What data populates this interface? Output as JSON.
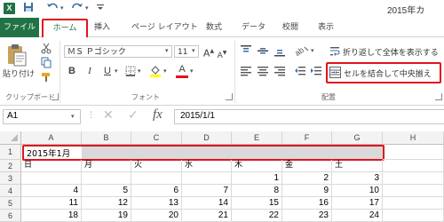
{
  "titlebar": {
    "app_logo": "X",
    "save_icon": "save-icon",
    "undo_icon": "undo-icon",
    "redo_icon": "redo-icon",
    "title": "2015年カ"
  },
  "ribbon_tabs": [
    "ファイル",
    "ホーム",
    "挿入",
    "ページ レイアウト",
    "数式",
    "データ",
    "校閲",
    "表示"
  ],
  "clipboard": {
    "paste_label": "貼り付け",
    "group_label": "クリップボード"
  },
  "font": {
    "font_name": "ＭＳ Ｐゴシック",
    "font_size": "11",
    "bold": "B",
    "italic": "I",
    "underline": "U",
    "group_label": "フォント",
    "font_color": "#e0141e"
  },
  "alignment": {
    "wrap_text_label": "折り返して全体を表示する",
    "merge_center_label": "セルを結合して中央揃え",
    "group_label": "配置"
  },
  "formula_bar": {
    "name_box": "A1",
    "cancel": "✕",
    "enter": "✓",
    "fx": "fx",
    "value": "2015/1/1"
  },
  "grid": {
    "columns": [
      "A",
      "B",
      "C",
      "D",
      "E",
      "F",
      "G",
      "H"
    ],
    "rows": [
      "1",
      "2",
      "3",
      "4",
      "5",
      "6"
    ],
    "a1_value": "2015年1月",
    "weekdays": [
      "日",
      "月",
      "火",
      "水",
      "木",
      "金",
      "土"
    ],
    "row3": [
      "",
      "",
      "",
      "",
      "1",
      "2",
      "3"
    ],
    "row4": [
      "4",
      "5",
      "6",
      "7",
      "8",
      "9",
      "10"
    ],
    "row5": [
      "11",
      "12",
      "13",
      "14",
      "15",
      "16",
      "17"
    ],
    "row6": [
      "18",
      "19",
      "20",
      "21",
      "22",
      "23",
      "24"
    ]
  },
  "colors": {
    "excel_green": "#217346",
    "highlight_red": "#e0141e"
  }
}
